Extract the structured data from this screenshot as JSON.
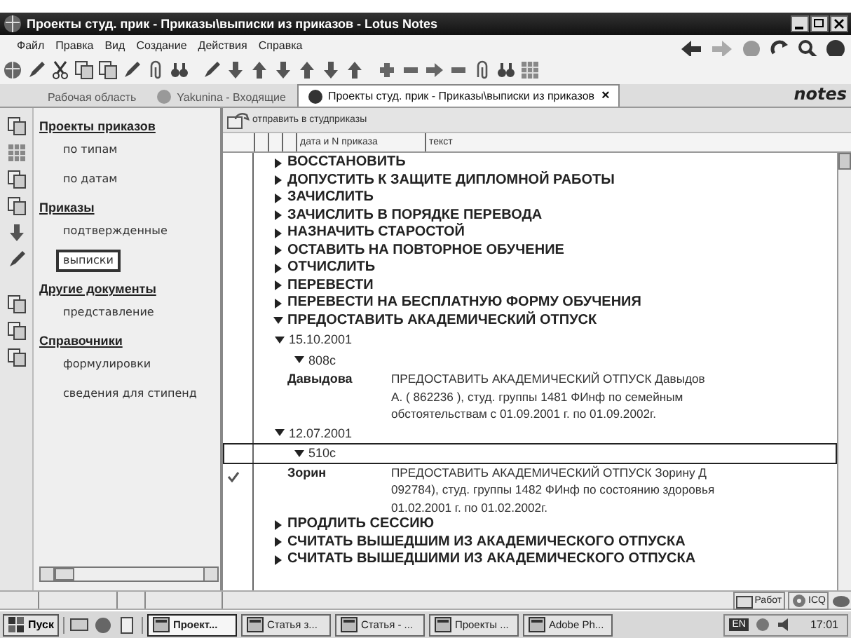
{
  "window": {
    "title": "Проекты студ. прик - Приказы\\выписки из приказов - Lotus Notes"
  },
  "menu": [
    "Файл",
    "Правка",
    "Вид",
    "Создание",
    "Действия",
    "Справка"
  ],
  "tabs": [
    {
      "label": "Рабочая область",
      "selected": false
    },
    {
      "label": "Yakunina - Входящие",
      "selected": false
    },
    {
      "label": "Проекты студ. прик - Приказы\\выписки из приказов",
      "selected": true,
      "close": "×"
    }
  ],
  "brand": "notes",
  "navigator": [
    {
      "heading": "Проекты приказов",
      "items": [
        {
          "label": "по типам",
          "selected": false
        },
        {
          "label": "по датам",
          "selected": false
        }
      ]
    },
    {
      "heading": "Приказы",
      "items": [
        {
          "label": "подтвержденные",
          "selected": false
        },
        {
          "label": "выписки",
          "selected": true
        }
      ]
    },
    {
      "heading": "Другие документы",
      "items": [
        {
          "label": "представление",
          "selected": false
        }
      ]
    },
    {
      "heading": "Справочники",
      "items": [
        {
          "label": "формулировки",
          "selected": false
        },
        {
          "label": "сведения для стипенд",
          "selected": false
        }
      ]
    }
  ],
  "action": "отправить в студприказы",
  "columns": [
    "дата и N приказа",
    "текст"
  ],
  "tree": [
    {
      "kind": "category",
      "label": "ВОССТАНОВИТЬ",
      "expanded": false
    },
    {
      "kind": "category",
      "label": "ДОПУСТИТЬ К ЗАЩИТЕ ДИПЛОМНОЙ РАБОТЫ",
      "expanded": false
    },
    {
      "kind": "category",
      "label": "ЗАЧИСЛИТЬ",
      "expanded": false
    },
    {
      "kind": "category",
      "label": "ЗАЧИСЛИТЬ В ПОРЯДКЕ ПЕРЕВОДА",
      "expanded": false
    },
    {
      "kind": "category",
      "label": "НАЗНАЧИТЬ СТАРОСТОЙ",
      "expanded": false
    },
    {
      "kind": "category",
      "label": "ОСТАВИТЬ НА ПОВТОРНОЕ ОБУЧЕНИЕ",
      "expanded": false
    },
    {
      "kind": "category",
      "label": "ОТЧИСЛИТЬ",
      "expanded": false
    },
    {
      "kind": "category",
      "label": "ПЕРЕВЕСТИ",
      "expanded": false
    },
    {
      "kind": "category",
      "label": "ПЕРЕВЕСТИ НА БЕСПЛАТНУЮ ФОРМУ ОБУЧЕНИЯ",
      "expanded": false
    },
    {
      "kind": "category",
      "label": "ПРЕДОСТАВИТЬ АКАДЕМИЧЕСКИЙ ОТПУСК",
      "expanded": true,
      "children": [
        {
          "kind": "date",
          "label": "15.10.2001",
          "expanded": true,
          "selected": false,
          "children": [
            {
              "kind": "number",
              "label": "808с",
              "expanded": true,
              "selected": false,
              "children": [
                {
                  "kind": "document",
                  "name": "Давыдова",
                  "checked": false,
                  "lines": [
                    "ПРЕДОСТАВИТЬ АКАДЕМИЧЕСКИЙ ОТПУСК  Давыдов",
                    "А. ( 862236 ), студ. группы 1481 ФИнф по семейным",
                    "обстоятельствам с 01.09.2001 г. по 01.09.2002г."
                  ]
                }
              ]
            }
          ]
        },
        {
          "kind": "date",
          "label": "12.07.2001",
          "expanded": true,
          "selected": false,
          "children": [
            {
              "kind": "number",
              "label": "510с",
              "expanded": true,
              "selected": true,
              "children": [
                {
                  "kind": "document",
                  "name": "Зорин",
                  "checked": true,
                  "lines": [
                    "ПРЕДОСТАВИТЬ АКАДЕМИЧЕСКИЙ ОТПУСК  Зорину Д",
                    "092784), студ. группы 1482 ФИнф по состоянию здоровья",
                    "01.02.2001 г. по 01.02.2002г."
                  ]
                }
              ]
            }
          ]
        }
      ]
    },
    {
      "kind": "category",
      "label": "ПРОДЛИТЬ СЕССИЮ",
      "expanded": false
    },
    {
      "kind": "category",
      "label": "СЧИТАТЬ ВЫШЕДШИМ ИЗ АКАДЕМИЧЕСКОГО ОТПУСКА",
      "expanded": false
    },
    {
      "kind": "category",
      "label": "СЧИТАТЬ ВЫШЕДШИМИ ИЗ АКАДЕМИЧЕСКОГО ОТПУСКА",
      "expanded": false
    }
  ],
  "status_bar": [
    "Работ",
    "ICQ"
  ],
  "taskbar": {
    "start": "Пуск",
    "tasks": [
      {
        "label": "Проект...",
        "selected": true
      },
      {
        "label": "Статья з...",
        "selected": false
      },
      {
        "label": "Статья - ...",
        "selected": false
      },
      {
        "label": "Проекты ...",
        "selected": false
      },
      {
        "label": "Adobe Ph...",
        "selected": false
      }
    ],
    "language": "EN",
    "clock": "17:01"
  }
}
